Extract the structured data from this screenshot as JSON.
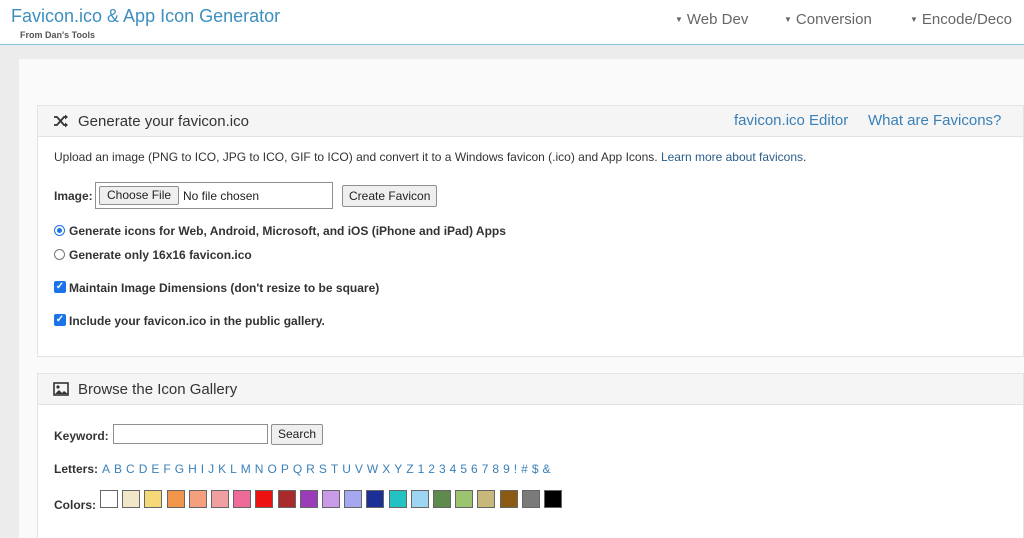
{
  "header": {
    "title": "Favicon.ico & App Icon Generator",
    "subtitle": "From Dan's Tools",
    "nav": [
      {
        "label": "Web Dev"
      },
      {
        "label": "Conversion"
      },
      {
        "label": "Encode/Deco"
      }
    ]
  },
  "generate_panel": {
    "title": "Generate your favicon.ico",
    "links": [
      {
        "label": "favicon.ico Editor"
      },
      {
        "label": "What are Favicons?"
      }
    ],
    "description": "Upload an image (PNG to ICO, JPG to ICO, GIF to ICO) and convert it to a Windows favicon (.ico) and App Icons.",
    "learn_more": "Learn more about favicons",
    "image_label": "Image:",
    "choose_file": "Choose File",
    "no_file": "No file chosen",
    "create_button": "Create Favicon",
    "options": [
      {
        "type": "radio",
        "checked": true,
        "label": "Generate icons for Web, Android, Microsoft, and iOS (iPhone and iPad) Apps"
      },
      {
        "type": "radio",
        "checked": false,
        "label": "Generate only 16x16 favicon.ico"
      },
      {
        "type": "checkbox",
        "checked": true,
        "label": "Maintain Image Dimensions (don't resize to be square)"
      },
      {
        "type": "checkbox",
        "checked": true,
        "label": "Include your favicon.ico in the public gallery."
      }
    ]
  },
  "gallery_panel": {
    "title": "Browse the Icon Gallery",
    "keyword_label": "Keyword:",
    "keyword_value": "",
    "search_button": "Search",
    "letters_label": "Letters:",
    "letters": [
      "A",
      "B",
      "C",
      "D",
      "E",
      "F",
      "G",
      "H",
      "I",
      "J",
      "K",
      "L",
      "M",
      "N",
      "O",
      "P",
      "Q",
      "R",
      "S",
      "T",
      "U",
      "V",
      "W",
      "X",
      "Y",
      "Z",
      "1",
      "2",
      "3",
      "4",
      "5",
      "6",
      "7",
      "8",
      "9",
      "!",
      "#",
      "$",
      "&"
    ],
    "colors_label": "Colors:",
    "colors": [
      "#ffffff",
      "#f2e6c8",
      "#f5d978",
      "#f0954a",
      "#f4a07e",
      "#f0a0a0",
      "#ee6a98",
      "#ee1111",
      "#a82a2a",
      "#9b3cb8",
      "#c99ae8",
      "#a5a8f0",
      "#1c2f96",
      "#24c2c2",
      "#9ed6f2",
      "#5f8a4e",
      "#9cc46e",
      "#c9b87c",
      "#8a5a14",
      "#7a7a7a",
      "#000000"
    ]
  }
}
